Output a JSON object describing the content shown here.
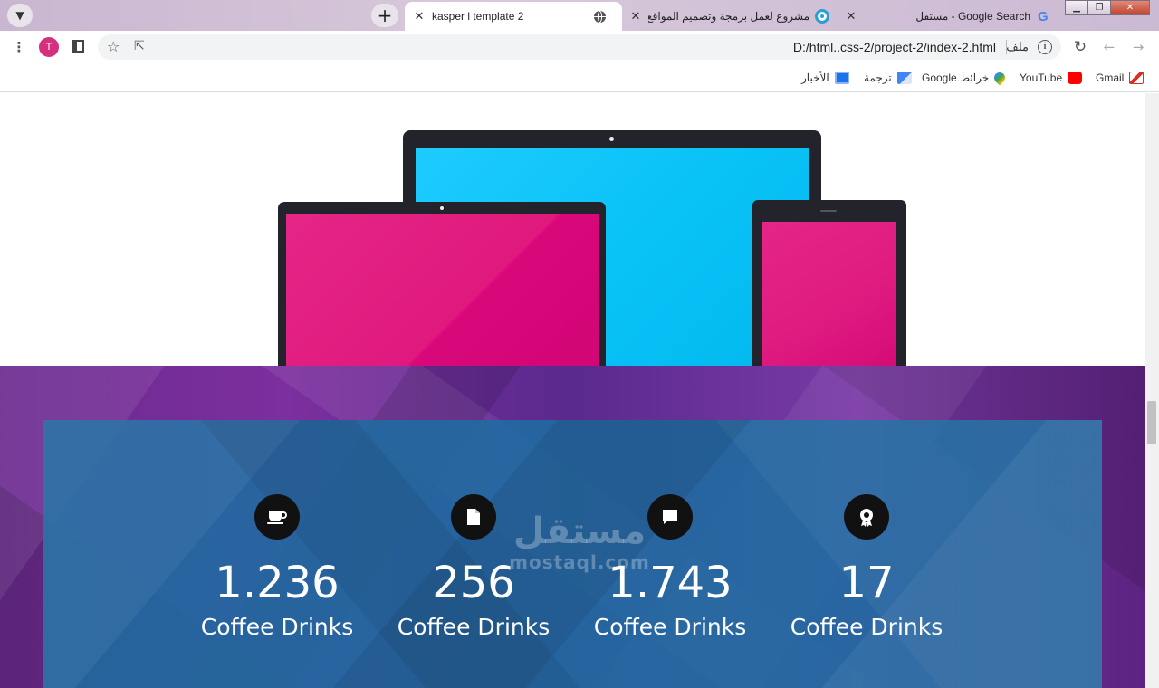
{
  "browser": {
    "tabs": [
      {
        "title": "kasper l template 2",
        "active": true
      },
      {
        "title": "مشروع لعمل برمجة وتصميم المواقع | مستقل",
        "active": false
      },
      {
        "title": "Google Search - مستقل",
        "active": false
      }
    ],
    "new_tab_symbol": "+",
    "close_symbol": "✕",
    "avatar_letter": "T",
    "address": {
      "scheme_label": "ملف",
      "url": "D:/html..css-2/project-2/index-2.html"
    },
    "bookmarks": [
      {
        "label": "Gmail",
        "icon": "gmail-icon",
        "color": "#d93025"
      },
      {
        "label": "YouTube",
        "icon": "youtube-icon",
        "color": "#ff0000"
      },
      {
        "label": "خرائط Google",
        "icon": "maps-icon",
        "color": "#34a853"
      },
      {
        "label": "ترجمة",
        "icon": "translate-icon",
        "color": "#4285f4"
      },
      {
        "label": "الأخبار",
        "icon": "news-icon",
        "color": "#1a73e8"
      }
    ]
  },
  "page": {
    "stats": [
      {
        "icon": "coffee-cup-icon",
        "number": "1.236",
        "label": "Coffee Drinks"
      },
      {
        "icon": "file-icon",
        "number": "256",
        "label": "Coffee Drinks"
      },
      {
        "icon": "comment-icon",
        "number": "1.743",
        "label": "Coffee Drinks"
      },
      {
        "icon": "award-icon",
        "number": "17",
        "label": "Coffee Drinks"
      }
    ],
    "watermark": {
      "arabic": "مستقل",
      "latin": "mostaql.com"
    },
    "colors": {
      "stats_overlay": "#1e6ca0",
      "section_bg": "#6b2a8f",
      "laptop_screen": "#09c2f6",
      "pink_screen": "#e0197d"
    }
  }
}
